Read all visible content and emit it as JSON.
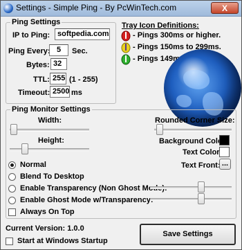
{
  "window": {
    "title": "Settings - Simple Ping - By PcWinTech.com",
    "close_label": "X"
  },
  "ping_settings": {
    "legend": "Ping Settings",
    "ip_label": "IP to Ping:",
    "ip_value": "softpedia.com",
    "ping_every_label": "Ping Every:",
    "ping_every_value": "5",
    "ping_every_unit": "Sec.",
    "bytes_label": "Bytes:",
    "bytes_value": "32",
    "ttl_label": "TTL:",
    "ttl_value": "255",
    "ttl_range": "(1 - 255)",
    "timeout_label": "Timeout:",
    "timeout_value": "2500",
    "timeout_unit": "ms"
  },
  "tray": {
    "title": "Tray Icon Definitions:",
    "rows": [
      {
        "text": "- Pings 300ms or higher.",
        "icon": "red-signal-icon",
        "color": "#d42020"
      },
      {
        "text": "- Pings 150ms to 299ms.",
        "icon": "yellow-signal-icon",
        "color": "#e8d020"
      },
      {
        "text": "- Pings 149ms or lower.",
        "icon": "green-signal-icon",
        "color": "#30b030"
      }
    ]
  },
  "monitor": {
    "legend": "Ping Monitor Settings",
    "width_label": "Width:",
    "height_label": "Height:",
    "corner_label": "Rounded Corner Size:",
    "bg_color_label": "Background Color:",
    "bg_color": "#000000",
    "text_color_label": "Text Color:",
    "text_color": "#ffffff",
    "font_label": "Text Front:",
    "font_button": "...",
    "modes": [
      {
        "label": "Normal",
        "selected": true
      },
      {
        "label": "Blend To Desktop",
        "selected": false
      },
      {
        "label": "Enable Transparency (Non Ghost Mode):",
        "selected": false
      },
      {
        "label": "Enable Ghost Mode w/Transparency:",
        "selected": false
      }
    ],
    "always_on_top_label": "Always On Top"
  },
  "footer": {
    "version_label": "Current Version: 1.0.0",
    "startup_label": "Start at Windows Startup",
    "save_button": "Save Settings"
  }
}
